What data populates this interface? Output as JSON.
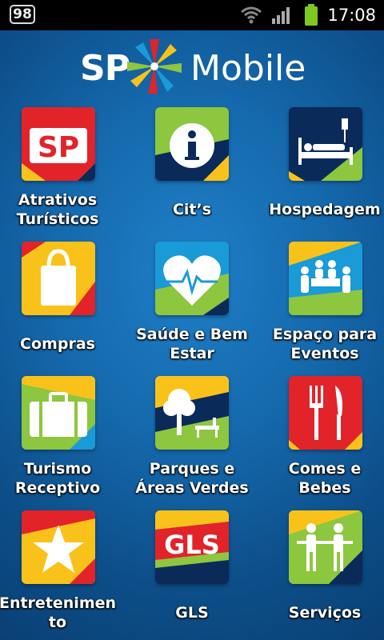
{
  "status_bar": {
    "notification_count": "98",
    "time": "17:08",
    "icons": [
      "wifi-icon",
      "signal-icon",
      "battery-icon"
    ]
  },
  "header": {
    "logo_sp": "SP",
    "logo_mobile": "Mobile"
  },
  "menu": [
    {
      "label_lines": [
        "Atrativos",
        "Turísticos"
      ],
      "icon": "sp-logo-icon"
    },
    {
      "label_lines": [
        "Cit’s"
      ],
      "icon": "info-icon"
    },
    {
      "label_lines": [
        "Hospedagem"
      ],
      "icon": "bed-icon"
    },
    {
      "label_lines": [
        "Compras"
      ],
      "icon": "shopping-bag-icon"
    },
    {
      "label_lines": [
        "Saúde e Bem",
        "Estar"
      ],
      "icon": "heart-pulse-icon"
    },
    {
      "label_lines": [
        "Espaço para",
        "Eventos"
      ],
      "icon": "meeting-icon"
    },
    {
      "label_lines": [
        "Turismo",
        "Receptivo"
      ],
      "icon": "suitcase-icon"
    },
    {
      "label_lines": [
        "Parques e",
        "Áreas Verdes"
      ],
      "icon": "park-icon"
    },
    {
      "label_lines": [
        "Comes e",
        "Bebes"
      ],
      "icon": "fork-knife-icon"
    },
    {
      "label_lines": [
        "Entretenimen",
        "to"
      ],
      "icon": "star-icon"
    },
    {
      "label_lines": [
        "GLS"
      ],
      "icon": "gls-icon"
    },
    {
      "label_lines": [
        "Serviços"
      ],
      "icon": "service-icon"
    }
  ],
  "colors": {
    "red": "#e2232a",
    "yellow": "#f9c21a",
    "green": "#8dc63f",
    "navy": "#0a2a5a",
    "background": "#1569ad"
  }
}
